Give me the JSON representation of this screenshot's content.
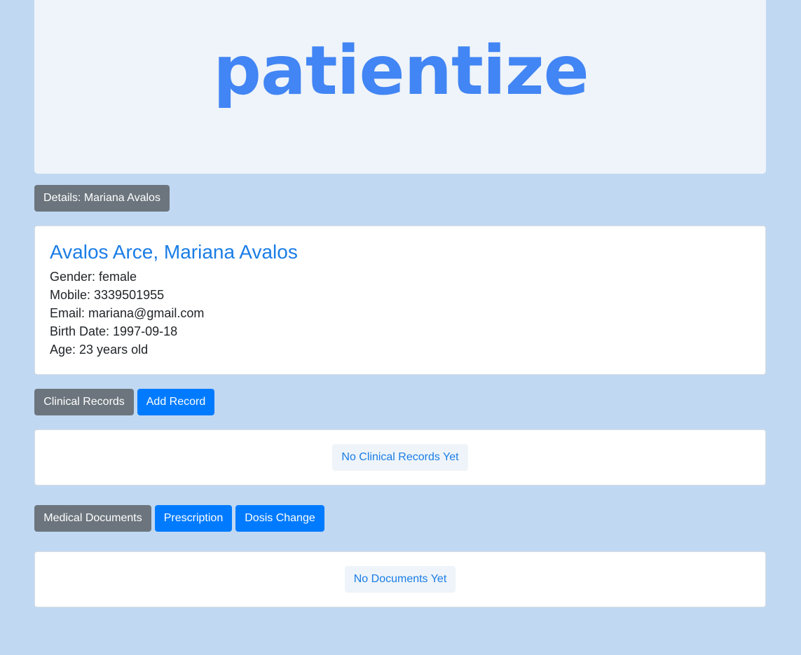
{
  "header": {
    "logo_text": "patientize"
  },
  "details": {
    "button_label": "Details: Mariana Avalos"
  },
  "patient": {
    "full_name": "Avalos Arce, Mariana Avalos",
    "gender": "Gender: female",
    "mobile": "Mobile: 3339501955",
    "email": "Email: mariana@gmail.com",
    "birth_date": "Birth Date: 1997-09-18",
    "age": "Age: 23 years old"
  },
  "clinical_records": {
    "section_label": "Clinical Records",
    "add_label": "Add Record",
    "empty_text": "No Clinical Records Yet"
  },
  "medical_documents": {
    "section_label": "Medical Documents",
    "prescription_label": "Prescription",
    "dosis_change_label": "Dosis Change",
    "empty_text": "No Documents Yet"
  },
  "colors": {
    "page_background": "#c1d8f2",
    "brand_blue": "#4285f4",
    "primary": "#007bff",
    "secondary": "#6c757d"
  }
}
